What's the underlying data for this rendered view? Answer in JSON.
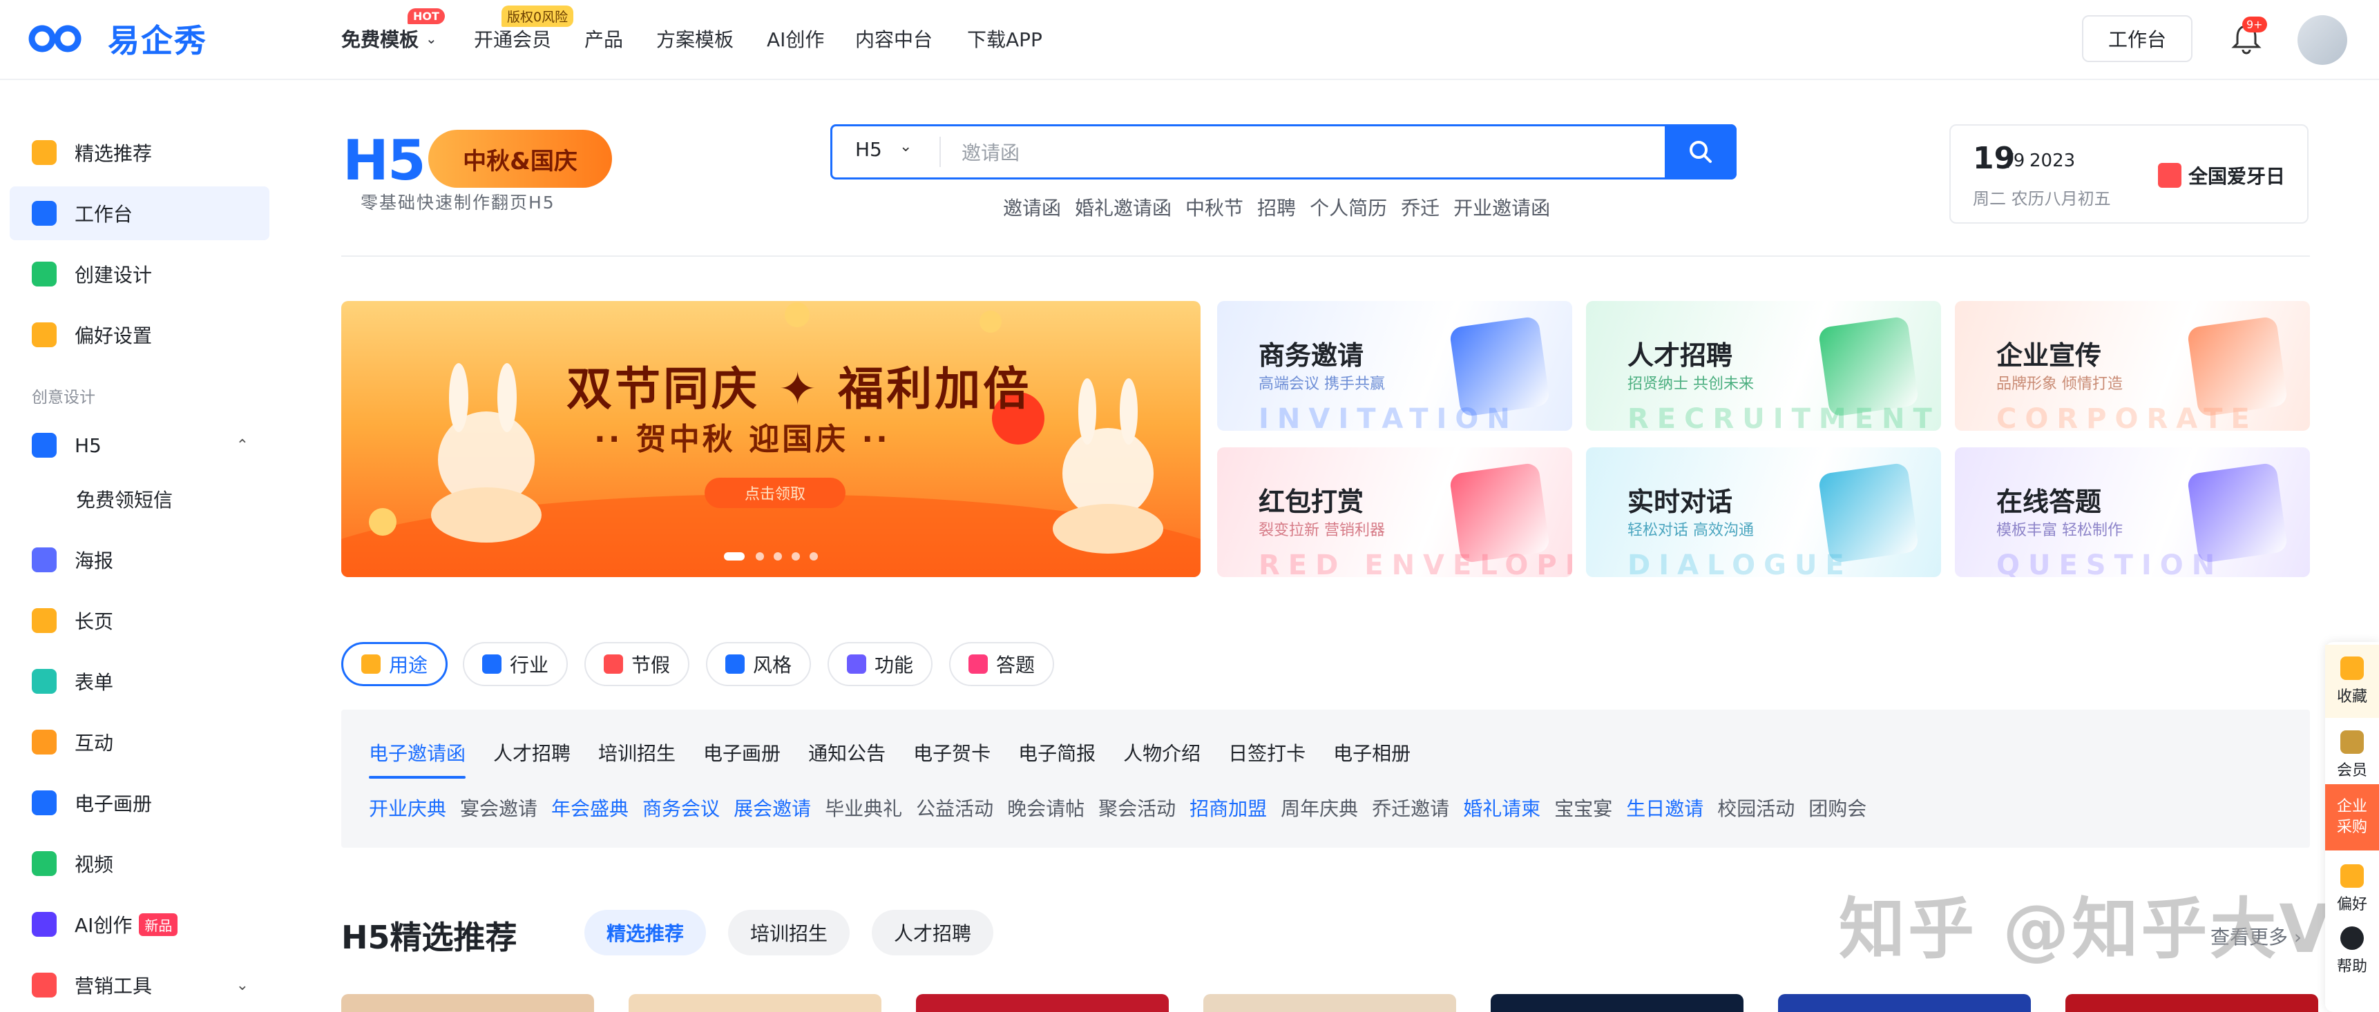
{
  "brand": {
    "name": "易企秀"
  },
  "nav": {
    "items": [
      {
        "label": "免费模板",
        "badge": "HOT"
      },
      {
        "label": "开通会员",
        "badge": "版权0风险"
      },
      {
        "label": "产品"
      },
      {
        "label": "方案模板"
      },
      {
        "label": "AI创作"
      },
      {
        "label": "内容中台"
      },
      {
        "label": "下载APP"
      }
    ],
    "workbench": "工作台",
    "notifications": "9+"
  },
  "sidebar": {
    "items": [
      {
        "label": "精选推荐",
        "icon": "home-icon",
        "color": "#ffb020"
      },
      {
        "label": "工作台",
        "icon": "dashboard-icon",
        "color": "#1a6dff",
        "active": true
      },
      {
        "label": "创建设计",
        "icon": "plus-icon",
        "color": "#21c26b"
      },
      {
        "label": "偏好设置",
        "icon": "settings-icon",
        "color": "#ffb020"
      }
    ],
    "section_label": "创意设计",
    "design_items": [
      {
        "label": "H5",
        "icon": "h5-icon",
        "color": "#1a6dff"
      },
      {
        "label": "免费领短信"
      },
      {
        "label": "海报",
        "icon": "image-icon",
        "color": "#5b6cff"
      },
      {
        "label": "长页",
        "icon": "document-icon",
        "color": "#ffb020"
      },
      {
        "label": "表单",
        "icon": "form-icon",
        "color": "#23c3b0"
      },
      {
        "label": "互动",
        "icon": "game-icon",
        "color": "#ff9a1f"
      },
      {
        "label": "电子画册",
        "icon": "book-icon",
        "color": "#1a6dff"
      },
      {
        "label": "视频",
        "icon": "video-icon",
        "color": "#21c26b"
      },
      {
        "label": "AI创作",
        "icon": "ai-icon",
        "color": "#5b3cff",
        "badge": "新品"
      },
      {
        "label": "营销工具",
        "icon": "toolbox-icon",
        "color": "#ff4d4f"
      }
    ]
  },
  "hero": {
    "logo_text": "H5",
    "promo": "中秋&国庆",
    "subtitle": "零基础快速制作翻页H5"
  },
  "search": {
    "type": "H5",
    "placeholder": "邀请函",
    "hot_words": [
      "邀请函",
      "婚礼邀请函",
      "中秋节",
      "招聘",
      "个人简历",
      "乔迁",
      "开业邀请函"
    ]
  },
  "date_card": {
    "day": "19",
    "month": "/9",
    "year": "2023",
    "lunar": "周二  农历八月初五",
    "festival": "全国爱牙日"
  },
  "banner": {
    "title": "双节同庆 ✦ 福利加倍",
    "subtitle": "·· 贺中秋 迎国庆 ··",
    "button": "点击领取"
  },
  "categories": [
    {
      "title": "商务邀请",
      "subtitle": "高端会议 携手共赢",
      "watermark": "INVITATION",
      "bg": "#e6eeff",
      "accent": "#2f6bff",
      "sub_color": "#6f8fd6"
    },
    {
      "title": "人才招聘",
      "subtitle": "招贤纳士 共创未来",
      "watermark": "RECRUITMENT",
      "bg": "#ddf7ea",
      "accent": "#21c26b",
      "sub_color": "#4caf80"
    },
    {
      "title": "企业宣传",
      "subtitle": "品牌形象 倾情打造",
      "watermark": "CORPORATE",
      "bg": "#ffe9e2",
      "accent": "#ff8a5c",
      "sub_color": "#c98b74"
    },
    {
      "title": "红包打赏",
      "subtitle": "裂变拉新 营销利器",
      "watermark": "RED ENVELOPE",
      "bg": "#ffe3e8",
      "accent": "#ff4d6a",
      "sub_color": "#d67a86"
    },
    {
      "title": "实时对话",
      "subtitle": "轻松对话 高效沟通",
      "watermark": "DIALOGUE",
      "bg": "#d9f4fb",
      "accent": "#2fb6e0",
      "sub_color": "#4aa5bf"
    },
    {
      "title": "在线答题",
      "subtitle": "模板丰富 轻松制作",
      "watermark": "QUESTION",
      "bg": "#ece6ff",
      "accent": "#7a6cff",
      "sub_color": "#8d84c9"
    }
  ],
  "filters": [
    {
      "label": "用途",
      "icon": "grid-icon",
      "color": "#ffb020",
      "active": true
    },
    {
      "label": "行业",
      "icon": "building-icon",
      "color": "#1a6dff"
    },
    {
      "label": "节假",
      "icon": "lantern-icon",
      "color": "#ff4d4f"
    },
    {
      "label": "风格",
      "icon": "palette-icon",
      "color": "#1a6dff"
    },
    {
      "label": "功能",
      "icon": "gear-icon",
      "color": "#6a5cff"
    },
    {
      "label": "答题",
      "icon": "quiz-icon",
      "color": "#ff3b7a"
    }
  ],
  "subtabs": [
    "电子邀请函",
    "人才招聘",
    "培训招生",
    "电子画册",
    "通知公告",
    "电子贺卡",
    "电子简报",
    "人物介绍",
    "日签打卡",
    "电子相册"
  ],
  "tags": [
    {
      "label": "开业庆典",
      "hl": true
    },
    {
      "label": "宴会邀请"
    },
    {
      "label": "年会盛典",
      "hl": true
    },
    {
      "label": "商务会议",
      "hl": true
    },
    {
      "label": "展会邀请",
      "hl": true
    },
    {
      "label": "毕业典礼"
    },
    {
      "label": "公益活动"
    },
    {
      "label": "晚会请帖"
    },
    {
      "label": "聚会活动"
    },
    {
      "label": "招商加盟",
      "hl": true
    },
    {
      "label": "周年庆典"
    },
    {
      "label": "乔迁邀请"
    },
    {
      "label": "婚礼请柬",
      "hl": true
    },
    {
      "label": "宝宝宴"
    },
    {
      "label": "生日邀请",
      "hl": true
    },
    {
      "label": "校园活动"
    },
    {
      "label": "团购会"
    }
  ],
  "recommend": {
    "title": "H5精选推荐",
    "tabs": [
      "精选推荐",
      "培训招生",
      "人才招聘"
    ],
    "more": "查看更多",
    "thumb_colors": [
      "#e8c9a8",
      "#f2d9b8",
      "#c0182a",
      "#ead7bf",
      "#0d1e3a",
      "#1f3fa8",
      "#b8141f"
    ]
  },
  "watermark": "知乎 @知乎大V",
  "floatbar": [
    {
      "label": "收藏",
      "icon": "star-icon",
      "color": "#ffb020"
    },
    {
      "label": "会员",
      "icon": "vip-icon",
      "color": "#c99a3a"
    },
    {
      "label": "企业采购",
      "icon": "",
      "color": "#ff6a3d"
    },
    {
      "label": "偏好",
      "icon": "preference-icon",
      "color": "#ffb020"
    },
    {
      "label": "帮助",
      "icon": "help-icon",
      "color": "#1f2329"
    }
  ]
}
